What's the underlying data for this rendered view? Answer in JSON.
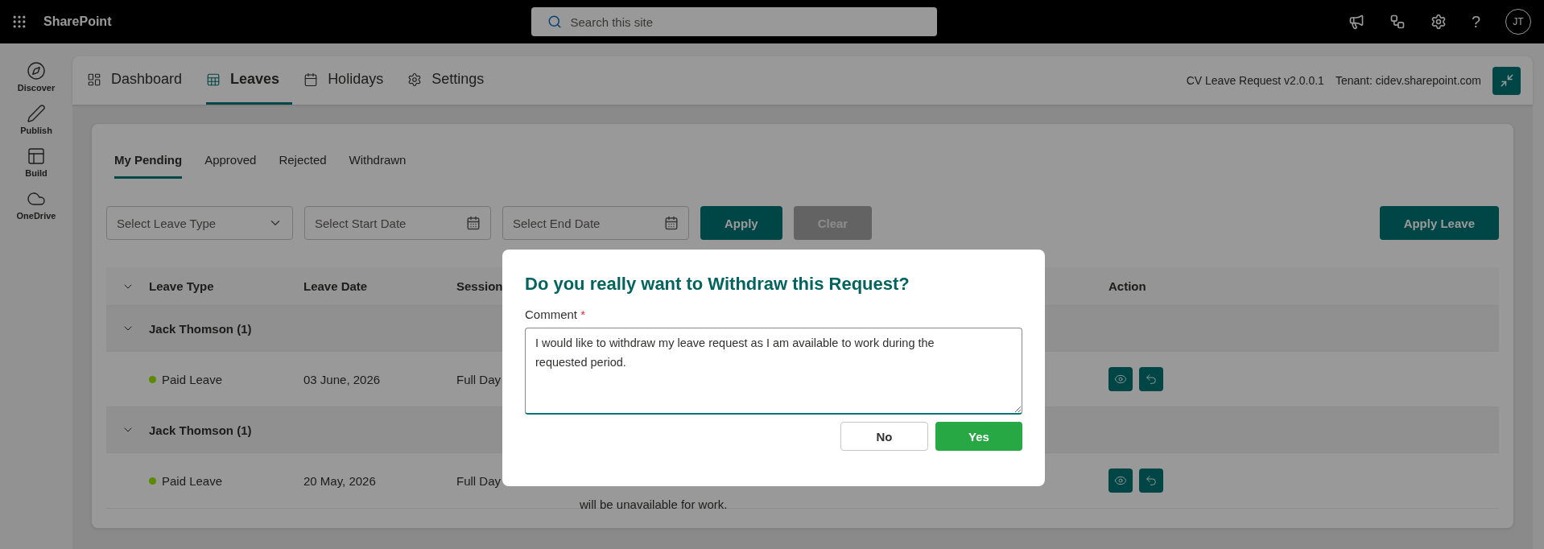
{
  "top_bar": {
    "app_name": "SharePoint",
    "search": {
      "placeholder": "Search this site"
    },
    "help": "?",
    "avatar": "JT"
  },
  "left_rail": {
    "items": [
      {
        "label": "Discover"
      },
      {
        "label": "Publish"
      },
      {
        "label": "Build"
      },
      {
        "label": "OneDrive"
      }
    ]
  },
  "app_tabs": [
    {
      "label": "Dashboard",
      "selected": false
    },
    {
      "label": "Leaves",
      "selected": true
    },
    {
      "label": "Holidays",
      "selected": false
    },
    {
      "label": "Settings",
      "selected": false
    }
  ],
  "app_info": {
    "version": "CV Leave Request v2.0.0.1",
    "tenant": "Tenant: cidev.sharepoint.com"
  },
  "sub_tabs": [
    {
      "label": "My Pending",
      "selected": true
    },
    {
      "label": "Approved",
      "selected": false
    },
    {
      "label": "Rejected",
      "selected": false
    },
    {
      "label": "Withdrawn",
      "selected": false
    }
  ],
  "filters": {
    "leave_type": {
      "placeholder": "Select Leave Type"
    },
    "start_date": {
      "placeholder": "Select Start Date"
    },
    "end_date": {
      "placeholder": "Select End Date"
    },
    "apply": {
      "label": "Apply",
      "disabled": false
    },
    "clear": {
      "label": "Clear",
      "disabled": true
    }
  },
  "apply_leave_button": "Apply Leave",
  "table": {
    "columns": [
      "Leave Type",
      "Leave Date",
      "Session",
      "",
      "Action"
    ],
    "groups": [
      {
        "title": "Jack Thomson (1)",
        "expanded": true,
        "rows": [
          {
            "leave_type": "Paid Leave",
            "color": "#5a8a00",
            "leave_date": "03 June, 2026",
            "session": "Full Day"
          }
        ]
      },
      {
        "title": "Jack Thomson (1)",
        "expanded": true,
        "rows": [
          {
            "leave_type": "Paid Leave",
            "color": "#5a8a00",
            "leave_date": "20 May, 2026",
            "session": "Full Day",
            "column_4": "will be unavailable for work."
          }
        ]
      }
    ]
  },
  "dialog": {
    "title": "Do you really want to Withdraw this Request?",
    "comment_label": "Comment",
    "required": true,
    "required_mark": "*",
    "comment": "I would like to withdraw my leave request as I am available to work during the requested period.",
    "no": "No",
    "yes": "Yes"
  }
}
